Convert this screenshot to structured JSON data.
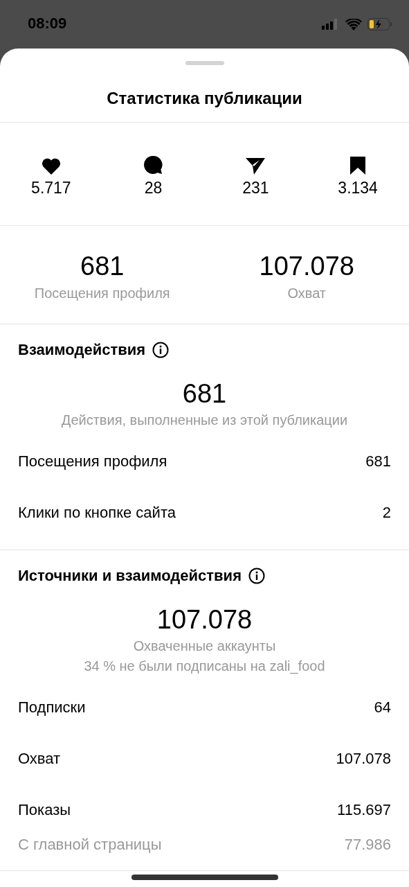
{
  "status_bar": {
    "time": "08:09"
  },
  "sheet": {
    "title": "Статистика публикации",
    "counts": [
      {
        "kind": "like",
        "value": "5.717"
      },
      {
        "kind": "comment",
        "value": "28"
      },
      {
        "kind": "share",
        "value": "231"
      },
      {
        "kind": "save",
        "value": "3.134"
      }
    ],
    "summary": [
      {
        "value": "681",
        "label": "Посещения профиля"
      },
      {
        "value": "107.078",
        "label": "Охват"
      }
    ],
    "sections": [
      {
        "title": "Взаимодействия",
        "total": "681",
        "captions": [
          "Действия, выполненные из этой публикации"
        ],
        "rows": [
          {
            "kind": "main",
            "label": "Посещения профиля",
            "value": "681"
          },
          {
            "kind": "main",
            "label": "Клики по кнопке сайта",
            "value": "2"
          }
        ]
      },
      {
        "title": "Источники и взаимодействия",
        "total": "107.078",
        "captions": [
          "Охваченные аккаунты",
          "34 % не были подписаны на zali_food"
        ],
        "rows": [
          {
            "kind": "main",
            "label": "Подписки",
            "value": "64"
          },
          {
            "kind": "main",
            "label": "Охват",
            "value": "107.078"
          },
          {
            "kind": "main",
            "label": "Показы",
            "value": "115.697"
          },
          {
            "kind": "sub",
            "label": "С главной страницы",
            "value": "77.986"
          }
        ]
      }
    ]
  }
}
